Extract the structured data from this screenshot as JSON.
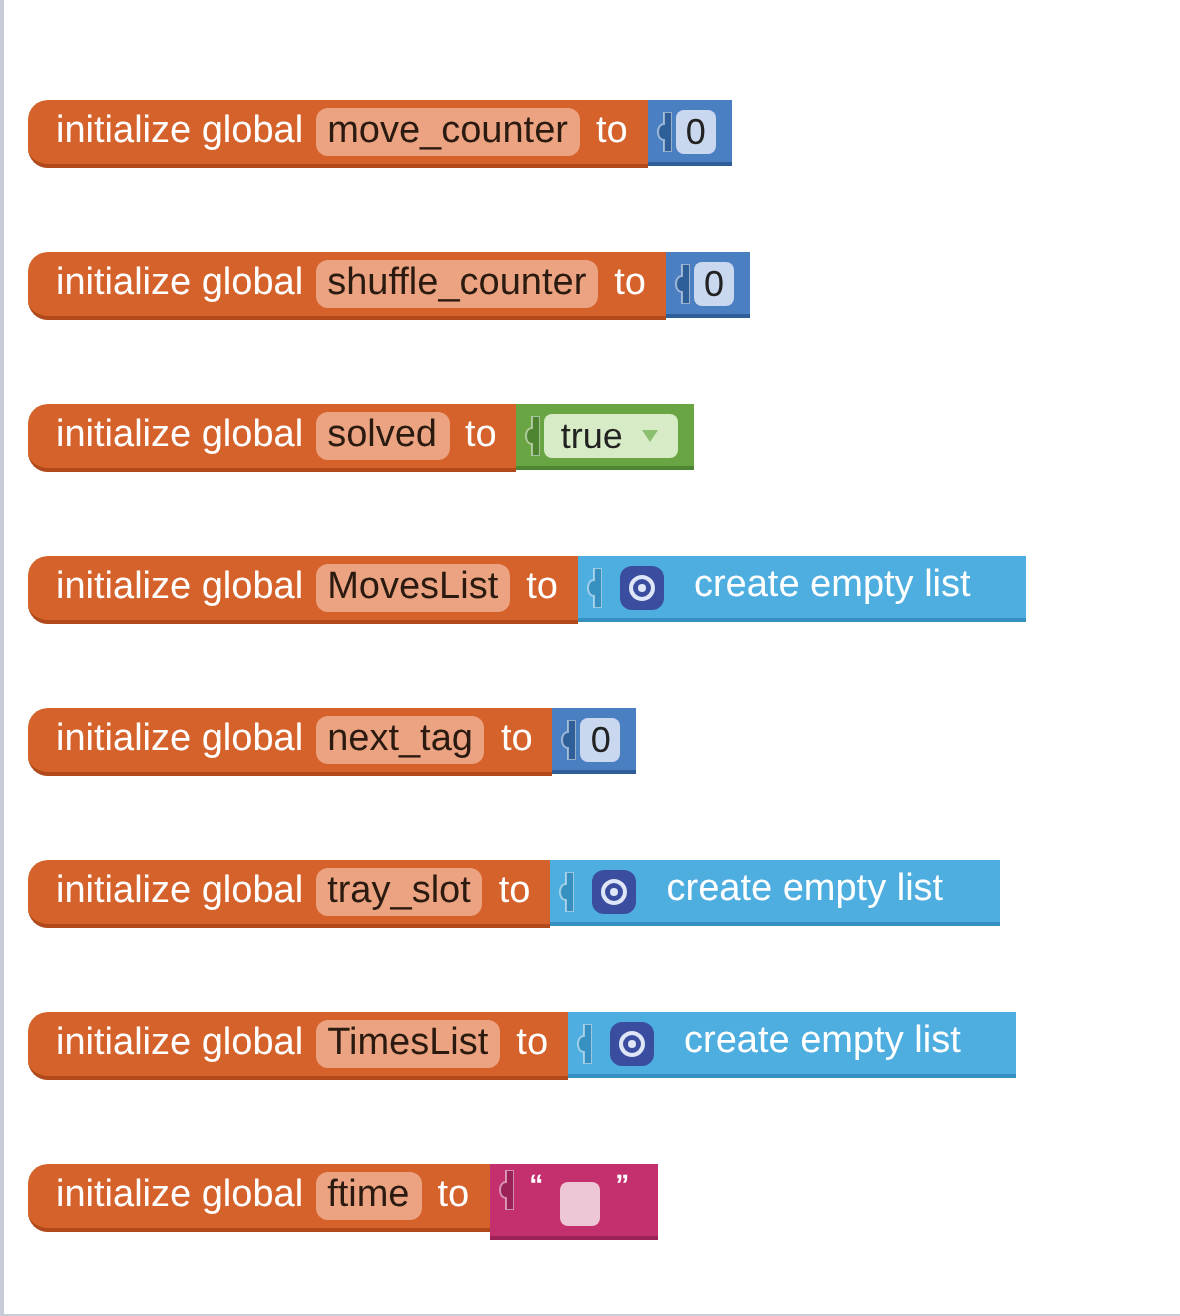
{
  "blocks": [
    {
      "label": "initialize global",
      "name": "move_counter",
      "to": "to",
      "value": {
        "kind": "number",
        "text": "0"
      }
    },
    {
      "label": "initialize global",
      "name": "shuffle_counter",
      "to": "to",
      "value": {
        "kind": "number",
        "text": "0"
      }
    },
    {
      "label": "initialize global",
      "name": "solved",
      "to": "to",
      "value": {
        "kind": "boolean",
        "text": "true"
      }
    },
    {
      "label": "initialize global",
      "name": "MovesList",
      "to": "to",
      "value": {
        "kind": "list",
        "text": "create empty list"
      }
    },
    {
      "label": "initialize global",
      "name": "next_tag",
      "to": "to",
      "value": {
        "kind": "number",
        "text": "0"
      }
    },
    {
      "label": "initialize global",
      "name": "tray_slot",
      "to": "to",
      "value": {
        "kind": "list",
        "text": "create empty list"
      }
    },
    {
      "label": "initialize global",
      "name": "TimesList",
      "to": "to",
      "value": {
        "kind": "list",
        "text": "create empty list"
      }
    },
    {
      "label": "initialize global",
      "name": "ftime",
      "to": "to",
      "value": {
        "kind": "text",
        "open_quote": "“",
        "close_quote": "”"
      }
    }
  ]
}
